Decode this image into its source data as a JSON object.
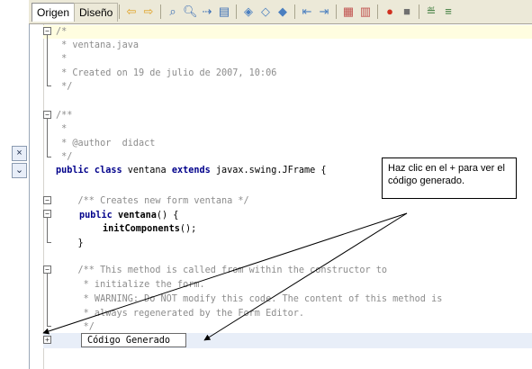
{
  "tabs": [
    {
      "label": "Origen",
      "active": true
    },
    {
      "label": "Diseño",
      "active": false
    }
  ],
  "toolbar_icons": [
    "back-icon",
    "forward-icon",
    "find-selection-icon",
    "find-icon",
    "find-next-icon",
    "toggle-highlight-icon",
    "prev-bookmark-icon",
    "next-bookmark-icon",
    "toggle-bookmark-icon",
    "shift-left-icon",
    "shift-right-icon",
    "start-macro-icon",
    "stop-macro-icon",
    "comment-icon",
    "uncomment-icon"
  ],
  "left_controls": {
    "close_glyph": "×",
    "menu_glyph": "⌄"
  },
  "code_lines": [
    {
      "text": "/*",
      "kind": "comment"
    },
    {
      "text": " * ventana.java",
      "kind": "comment"
    },
    {
      "text": " *",
      "kind": "comment"
    },
    {
      "text": " * Created on 19 de julio de 2007, 10:06",
      "kind": "comment"
    },
    {
      "text": " */",
      "kind": "comment"
    },
    {
      "text": "",
      "kind": "blank"
    },
    {
      "text": "/**",
      "kind": "comment"
    },
    {
      "text": " *",
      "kind": "comment"
    },
    {
      "text": " * @author  didact",
      "kind": "comment"
    },
    {
      "text": " */",
      "kind": "comment"
    },
    {
      "text": "",
      "kind": "blank"
    },
    {
      "text": "",
      "kind": "blank"
    },
    {
      "text": "    /** Creates new form ventana */",
      "kind": "comment"
    },
    {
      "text": "",
      "kind": "blank"
    },
    {
      "text": "",
      "kind": "blank"
    },
    {
      "text": "    }",
      "kind": "code"
    },
    {
      "text": "",
      "kind": "blank"
    },
    {
      "text": "    /** This method is called from within the constructor to",
      "kind": "comment"
    },
    {
      "text": "     * initialize the form.",
      "kind": "comment"
    },
    {
      "text": "     * WARNING: Do NOT modify this code. The content of this method is",
      "kind": "comment"
    },
    {
      "text": "     * always regenerated by the Form Editor.",
      "kind": "comment"
    },
    {
      "text": "     */",
      "kind": "comment"
    }
  ],
  "class_decl": {
    "kw1": "public class",
    "name": " ventana ",
    "kw2": "extends",
    "rest": " javax.swing.JFrame {"
  },
  "ctor_decl": {
    "kw": "public",
    "name": " ventana",
    "rest": "() {"
  },
  "init_call": {
    "name": "initComponents",
    "rest": "();"
  },
  "generated_code_label": "Código Generado",
  "callout_text": "Haz clic en el + para ver el código generado."
}
